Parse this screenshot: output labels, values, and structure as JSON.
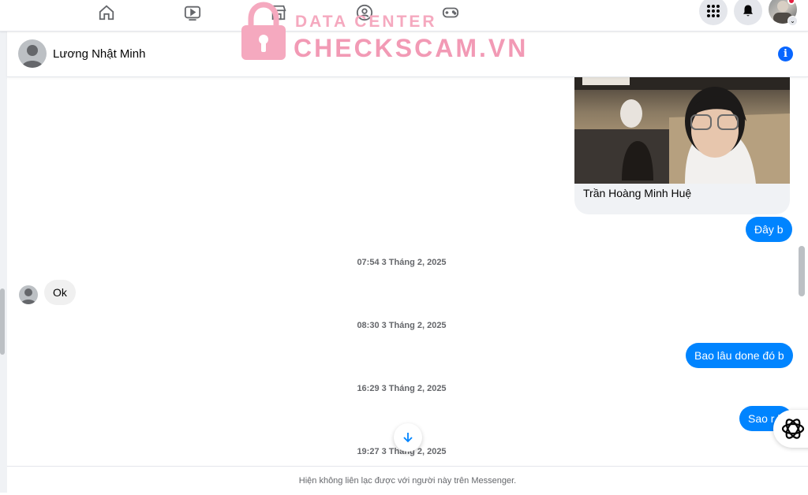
{
  "topnav": {
    "icons": [
      "home-icon",
      "video-icon",
      "marketplace-icon",
      "groups-icon",
      "gaming-icon"
    ],
    "right_icons": [
      "menu-grid-icon",
      "notifications-icon",
      "account-avatar"
    ]
  },
  "watermark": {
    "line1": "DATA CENTER",
    "line2": "CHECKSCAM.VN"
  },
  "chat": {
    "contact_name": "Lương Nhật Minh",
    "shared_card_title": "Trần Hoàng Minh Huệ",
    "messages": [
      {
        "direction": "out",
        "text": "Đây b"
      },
      {
        "type": "timestamp",
        "text": "07:54 3 Tháng 2, 2025"
      },
      {
        "direction": "in",
        "text": "Ok"
      },
      {
        "type": "timestamp",
        "text": "08:30 3 Tháng 2, 2025"
      },
      {
        "direction": "out",
        "text": "Bao lâu done đó b"
      },
      {
        "type": "timestamp",
        "text": "16:29 3 Tháng 2, 2025"
      },
      {
        "direction": "out",
        "text": "Sao r b"
      },
      {
        "type": "timestamp",
        "text": "19:27 3 Tháng 2, 2025"
      }
    ],
    "footer_notice": "Hiện không liên lạc được với người này trên Messenger."
  },
  "colors": {
    "accent": "#0084ff",
    "info": "#0866ff",
    "incoming_bubble": "#f0f0f0",
    "watermark": "#f29ab5"
  }
}
